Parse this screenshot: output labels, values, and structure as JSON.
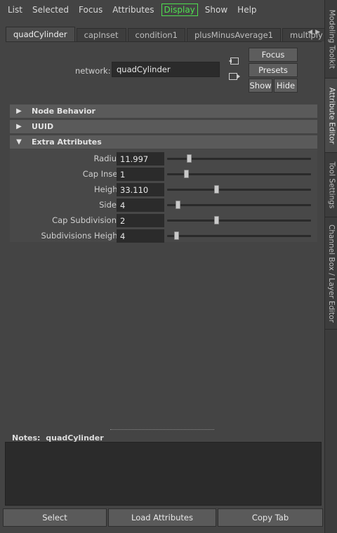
{
  "menubar": {
    "items": [
      "List",
      "Selected",
      "Focus",
      "Attributes",
      "Display",
      "Show",
      "Help"
    ]
  },
  "tabs": [
    {
      "label": "quadCylinder",
      "active": true
    },
    {
      "label": "capInset",
      "active": false
    },
    {
      "label": "condition1",
      "active": false
    },
    {
      "label": "plusMinusAverage1",
      "active": false
    },
    {
      "label": "multiply",
      "active": false
    }
  ],
  "tab_scroll": {
    "left_icon": "arrow-left-icon",
    "right_icon": "arrow-right-icon",
    "left_glyph": "◀",
    "right_glyph": "▶"
  },
  "node": {
    "label": "network:",
    "value": "quadCylinder"
  },
  "side_buttons": {
    "focus": "Focus",
    "presets": "Presets",
    "show": "Show",
    "hide": "Hide"
  },
  "sections": [
    {
      "title": "Node Behavior",
      "expanded": false,
      "glyph": "▶"
    },
    {
      "title": "UUID",
      "expanded": false,
      "glyph": "▶"
    },
    {
      "title": "Extra Attributes",
      "expanded": true,
      "glyph": "▼"
    }
  ],
  "attributes": [
    {
      "label": "Radius",
      "value": "11.997",
      "slider_fraction": 0.14
    },
    {
      "label": "Cap Inset",
      "value": "1",
      "slider_fraction": 0.12
    },
    {
      "label": "Height",
      "value": "33.110",
      "slider_fraction": 0.34
    },
    {
      "label": "Sides",
      "value": "4",
      "slider_fraction": 0.06
    },
    {
      "label": "Cap Subdivisions",
      "value": "2",
      "slider_fraction": 0.34
    },
    {
      "label": "Subdivisions Height",
      "value": "4",
      "slider_fraction": 0.05
    }
  ],
  "notes": {
    "label": "Notes:",
    "node": "quadCylinder",
    "text": ""
  },
  "bottom_buttons": {
    "select": "Select",
    "load_attributes": "Load Attributes",
    "copy_tab": "Copy Tab"
  },
  "side_tabs": [
    {
      "label": "Modeling Toolkit",
      "active": false
    },
    {
      "label": "Attribute Editor",
      "active": true
    },
    {
      "label": "Tool Settings",
      "active": false
    },
    {
      "label": "Channel Box / Layer Editor",
      "active": false
    }
  ],
  "colors": {
    "display_menu": "#4fe04f",
    "background": "#444444",
    "field": "#2b2b2b"
  }
}
